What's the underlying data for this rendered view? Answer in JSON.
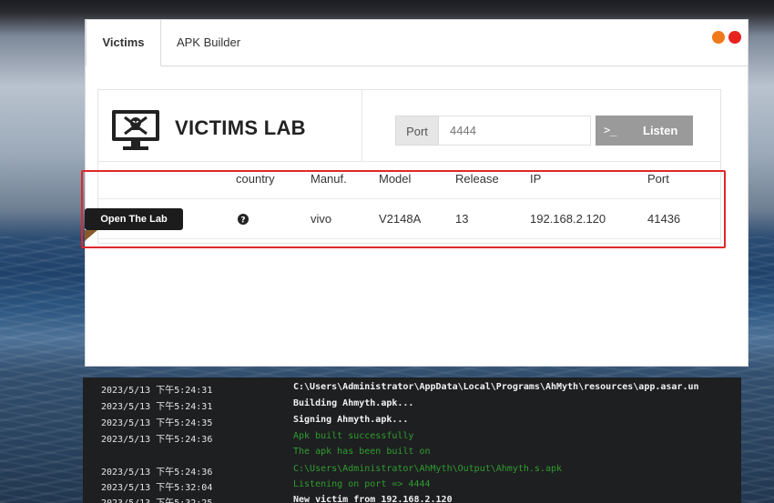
{
  "tabs": [
    {
      "label": "Victims",
      "active": true
    },
    {
      "label": "APK Builder",
      "active": false
    }
  ],
  "window_controls": [
    {
      "name": "minimize",
      "color": "#f07a1a"
    },
    {
      "name": "close",
      "color": "#e8231f"
    }
  ],
  "header": {
    "icon": "skull-monitor-icon",
    "title": "VICTIMS LAB",
    "port_label": "Port",
    "port_placeholder": "4444",
    "listen_icon": ">_",
    "listen_label": "Listen"
  },
  "table": {
    "columns": [
      "country",
      "Manuf.",
      "Model",
      "Release",
      "IP",
      "Port"
    ],
    "rows": [
      {
        "action": "Open The Lab",
        "country_icon": "question-circle-icon",
        "manuf": "vivo",
        "model": "V2148A",
        "release": "13",
        "ip": "192.168.2.120",
        "port": "41436"
      }
    ]
  },
  "console": {
    "lines": [
      {
        "time": "2023/5/13 下午5:24:31",
        "msg": "C:\\Users\\Administrator\\AppData\\Local\\Programs\\AhMyth\\resources\\app.asar.un",
        "color": "white"
      },
      {
        "time": "2023/5/13 下午5:24:31",
        "msg": "Building Ahmyth.apk...",
        "color": "white"
      },
      {
        "time": "2023/5/13 下午5:24:35",
        "msg": "Signing Ahmyth.apk...",
        "color": "white"
      },
      {
        "time": "2023/5/13 下午5:24:36",
        "msg": "Apk built successfully",
        "color": "green"
      },
      {
        "time": "",
        "msg": "The apk has been built on",
        "color": "green"
      },
      {
        "time": "2023/5/13 下午5:24:36",
        "msg": "C:\\Users\\Administrator\\AhMyth\\Output\\Ahmyth.s.apk",
        "color": "green"
      },
      {
        "time": "2023/5/13 下午5:32:04",
        "msg": "Listening on port => 4444",
        "color": "green"
      },
      {
        "time": "2023/5/13 下午5:32:25",
        "msg": "New victim from 192.168.2.120",
        "color": "white"
      }
    ]
  }
}
